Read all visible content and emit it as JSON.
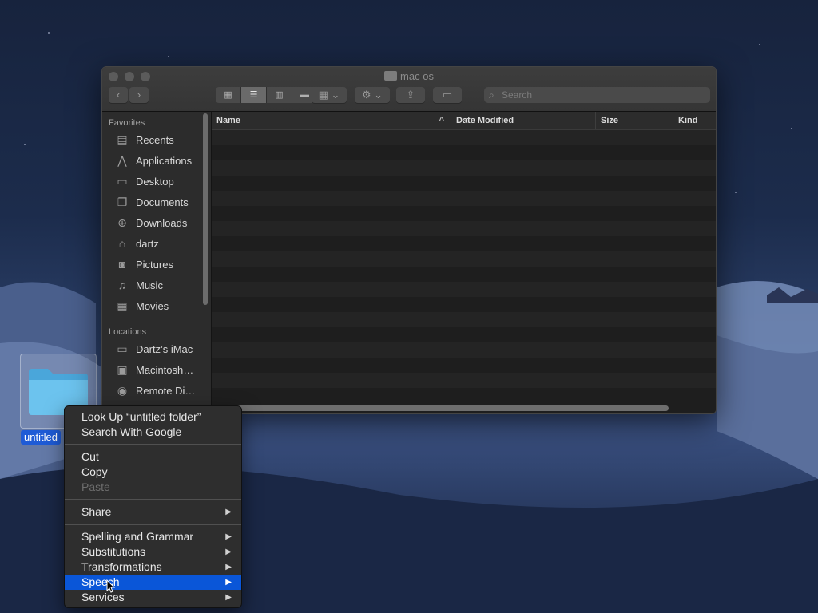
{
  "window": {
    "title": "mac os",
    "search_placeholder": "Search",
    "view_buttons": [
      "icon-view",
      "list-view",
      "column-view",
      "gallery-view"
    ],
    "active_view": "list-view"
  },
  "sidebar": {
    "favorites_header": "Favorites",
    "favorites": [
      {
        "label": "Recents",
        "icon": "clock-icon"
      },
      {
        "label": "Applications",
        "icon": "applications-icon"
      },
      {
        "label": "Desktop",
        "icon": "desktop-icon"
      },
      {
        "label": "Documents",
        "icon": "documents-icon"
      },
      {
        "label": "Downloads",
        "icon": "downloads-icon"
      },
      {
        "label": "dartz",
        "icon": "home-icon"
      },
      {
        "label": "Pictures",
        "icon": "camera-icon"
      },
      {
        "label": "Music",
        "icon": "music-icon"
      },
      {
        "label": "Movies",
        "icon": "film-icon"
      }
    ],
    "locations_header": "Locations",
    "locations": [
      {
        "label": "Dartz’s iMac",
        "icon": "imac-icon"
      },
      {
        "label": "Macintosh…",
        "icon": "disk-icon"
      },
      {
        "label": "Remote Di…",
        "icon": "disc-icon"
      }
    ]
  },
  "columns": {
    "name": "Name",
    "date_modified": "Date Modified",
    "size": "Size",
    "kind": "Kind"
  },
  "desktop": {
    "folder_label": "untitled"
  },
  "context_menu": {
    "items": [
      {
        "label": "Look Up “untitled folder”"
      },
      {
        "label": "Search With Google"
      },
      {
        "label": "Cut"
      },
      {
        "label": "Copy"
      },
      {
        "label": "Paste",
        "disabled": true
      },
      {
        "label": "Share",
        "submenu": true
      },
      {
        "label": "Spelling and Grammar",
        "submenu": true
      },
      {
        "label": "Substitutions",
        "submenu": true
      },
      {
        "label": "Transformations",
        "submenu": true
      },
      {
        "label": "Speech",
        "submenu": true,
        "highlighted": true
      },
      {
        "label": "Services",
        "submenu": true
      }
    ]
  },
  "colors": {
    "highlight": "#0a56d8",
    "menu_bg": "#2e2e2e",
    "window_bg": "#1e1e1e"
  }
}
